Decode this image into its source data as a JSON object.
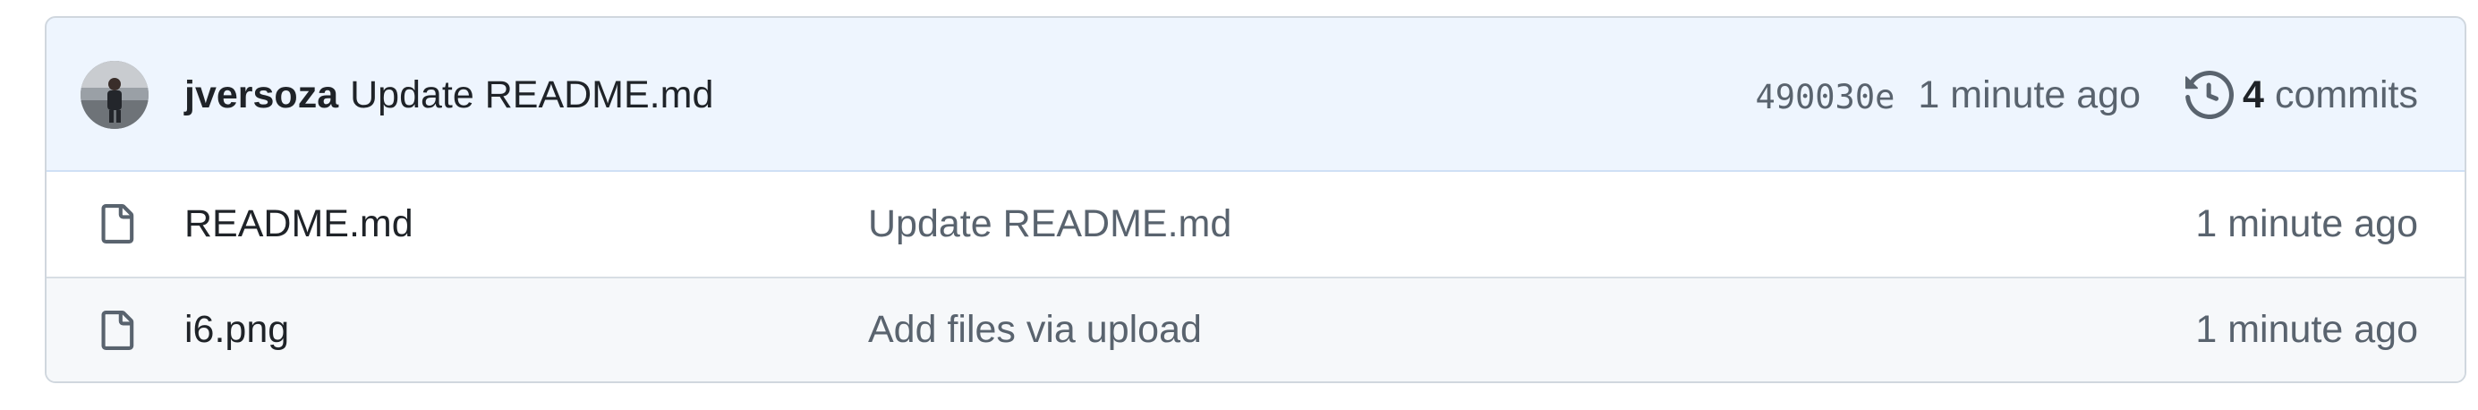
{
  "latest_commit": {
    "author": "jversoza",
    "message": "Update README.md",
    "sha": "490030e",
    "age": "1 minute ago",
    "commit_count": "4",
    "commits_label": "commits"
  },
  "files": [
    {
      "name": "README.md",
      "message": "Update README.md",
      "age": "1 minute ago",
      "icon": "file-icon"
    },
    {
      "name": "i6.png",
      "message": "Add files via upload",
      "age": "1 minute ago",
      "icon": "file-icon"
    }
  ],
  "colors": {
    "header_bg": "#eef5fe",
    "text_primary": "#1f2328",
    "text_muted": "#59636e",
    "border": "#d0d7de"
  }
}
